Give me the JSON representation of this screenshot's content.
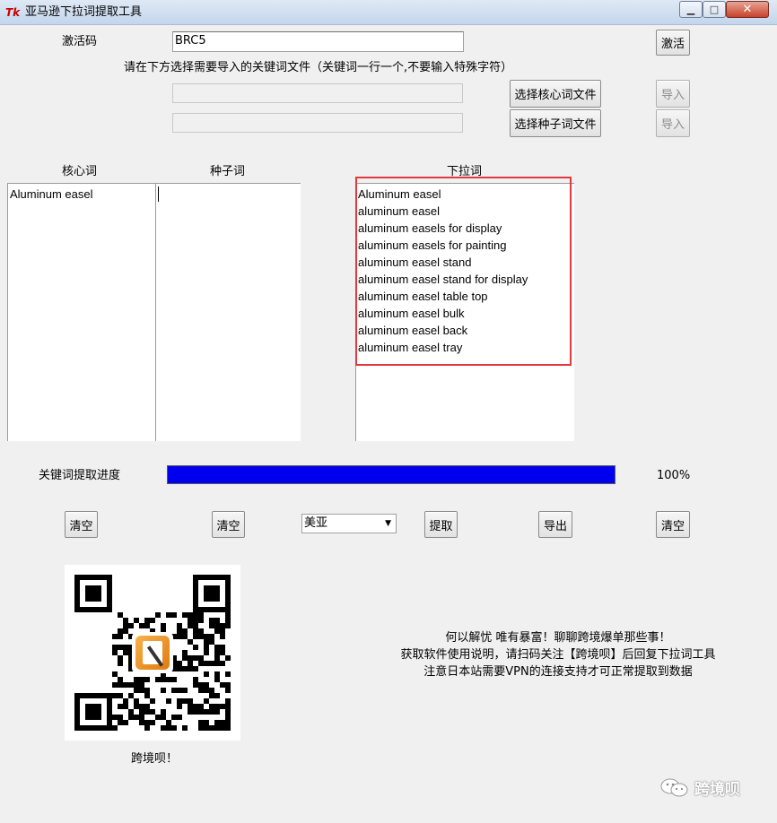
{
  "window": {
    "title": "亚马逊下拉词提取工具",
    "app_icon": "Tk",
    "minimize_icon": "minimize-icon",
    "maximize_icon": "maximize-icon",
    "close_icon": "close-icon"
  },
  "activation": {
    "label": "激活码",
    "code": "BRC5",
    "button": "激活"
  },
  "instruction": "请在下方选择需要导入的关键词文件（关键词一行一个,不要输入特殊字符）",
  "files": {
    "core_button": "选择核心词文件",
    "seed_button": "选择种子词文件",
    "import_label": "导入"
  },
  "columns": {
    "core": {
      "header": "核心词",
      "items": [
        "Aluminum easel"
      ]
    },
    "seed": {
      "header": "种子词",
      "items": []
    },
    "dropdown": {
      "header": "下拉词",
      "items": [
        "Aluminum easel",
        "aluminum easel",
        "aluminum easels for display",
        "aluminum easels for painting",
        "aluminum easel stand",
        "aluminum easel stand for display",
        "aluminum easel table top",
        "aluminum easel bulk",
        "aluminum easel back",
        "aluminum easel tray"
      ]
    }
  },
  "progress": {
    "label": "关键词提取进度",
    "value": 100,
    "text": "100%",
    "color": "#0000ee"
  },
  "actions": {
    "clear": "清空",
    "country_selected": "美亚",
    "extract": "提取",
    "export": "导出"
  },
  "promo": {
    "qr_caption": "跨境呗！",
    "line1": "何以解忧 唯有暴富！聊聊跨境爆单那些事！",
    "line2": "获取软件使用说明，请扫码关注【跨境呗】后回复下拉词工具",
    "line3": "注意日本站需要VPN的连接支持才可正常提取到数据"
  },
  "watermark": {
    "text": "跨境呗",
    "icon": "wechat-icon"
  },
  "colors": {
    "highlight": "#e0393e",
    "progress": "#0000ee"
  }
}
